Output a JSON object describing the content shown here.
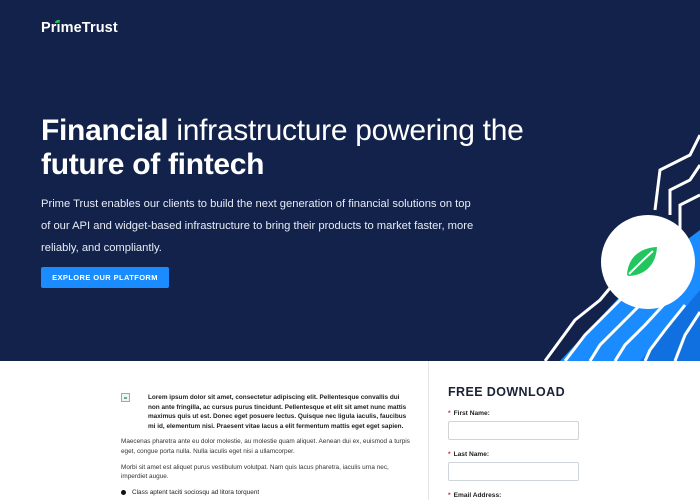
{
  "brand": {
    "logo_text": "PrimeTrust",
    "accent_color": "#22c55e"
  },
  "hero": {
    "headline_bold": "Financial",
    "headline_rest": " infrastructure powering the",
    "headline_line2": "future of fintech",
    "subtext": "Prime Trust enables our clients to build the next generation of financial solutions on top of our API and widget-based infrastructure to bring their products to market faster, more reliably, and compliantly.",
    "cta_label": "EXPLORE OUR PLATFORM",
    "background_color": "#13224a",
    "cta_color": "#1a8cff",
    "art_icon": "leaf-icon"
  },
  "article": {
    "lead": "Lorem ipsum dolor sit amet, consectetur adipiscing elit. Pellentesque convallis dui non ante fringilla, ac cursus purus tincidunt. Pellentesque et elit sit amet nunc mattis maximus quis ut est. Donec eget posuere lectus. Quisque nec ligula iaculis, faucibus mi id, elementum nisi. Praesent vitae lacus a elit fermentum mattis eget eget sapien.",
    "paragraph_1": "Maecenas pharetra ante eu dolor molestie, au molestie quam aliquet. Aenean dui ex, euismod a turpis eget, congue porta nulla. Nulla iaculis eget nisi a ullamcorper.",
    "paragraph_2": "Morbi sit amet est aliquet purus vestibulum volutpat. Nam quis lacus pharetra, iaculis urna nec, imperdiet augue.",
    "bullet_1": "Class aptent taciti sociosqu ad litora torquent"
  },
  "form": {
    "title": "FREE DOWNLOAD",
    "required_marker": "*",
    "fields": [
      {
        "label": "First Name:",
        "value": ""
      },
      {
        "label": "Last Name:",
        "value": ""
      },
      {
        "label": "Email Address:",
        "value": ""
      }
    ]
  }
}
